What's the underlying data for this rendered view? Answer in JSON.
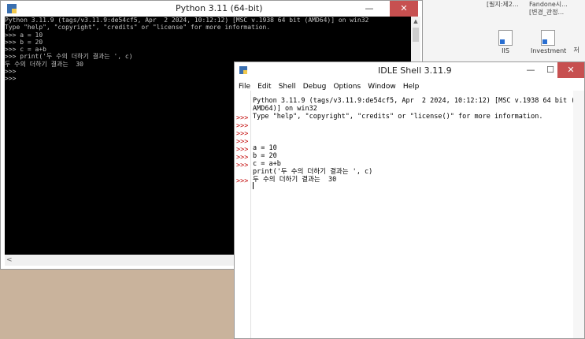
{
  "desktop": {
    "top_labels": [
      "[필지:제2...",
      "Fandone시...",
      "[변경_관정..."
    ],
    "shortcuts": [
      {
        "label": "IIS"
      },
      {
        "label": "Investment"
      },
      {
        "label": "저"
      }
    ]
  },
  "console": {
    "title": "Python 3.11 (64-bit)",
    "minimize_glyph": "—",
    "close_glyph": "✕",
    "lines": [
      "Python 3.11.9 (tags/v3.11.9:de54cf5, Apr  2 2024, 10:12:12) [MSC v.1938 64 bit (AMD64)] on win32",
      "Type \"help\", \"copyright\", \"credits\" or \"license\" for more information.",
      ">>> a = 10",
      ">>> b = 20",
      ">>> c = a+b",
      ">>> print('두 수의 더하기 결과는 ', c)",
      "두 수의 더하기 결과는  30",
      ">>>",
      ">>>"
    ],
    "scroll_up": "▲",
    "scroll_left": "<"
  },
  "idle": {
    "title": "IDLE Shell 3.11.9",
    "minimize_glyph": "—",
    "maximize_glyph": "☐",
    "close_glyph": "✕",
    "menu": [
      "File",
      "Edit",
      "Shell",
      "Debug",
      "Options",
      "Window",
      "Help"
    ],
    "banner_1": "Python 3.11.9 (tags/v3.11.9:de54cf5, Apr  2 2024, 10:12:12) [MSC v.1938 64 bit (",
    "banner_2": "AMD64)] on win32",
    "banner_3": "Type \"help\", \"copyright\", \"credits\" or \"license()\" for more information.",
    "prompt": ">>>",
    "code_a": "a = 10",
    "code_b": "b = 20",
    "code_c": "c = a+b",
    "print_fn": "print",
    "print_open": "(",
    "print_str": "'두 수의 더하기 결과는 '",
    "print_rest": ", c)",
    "output": "두 수의 더하기 결과는  30"
  }
}
